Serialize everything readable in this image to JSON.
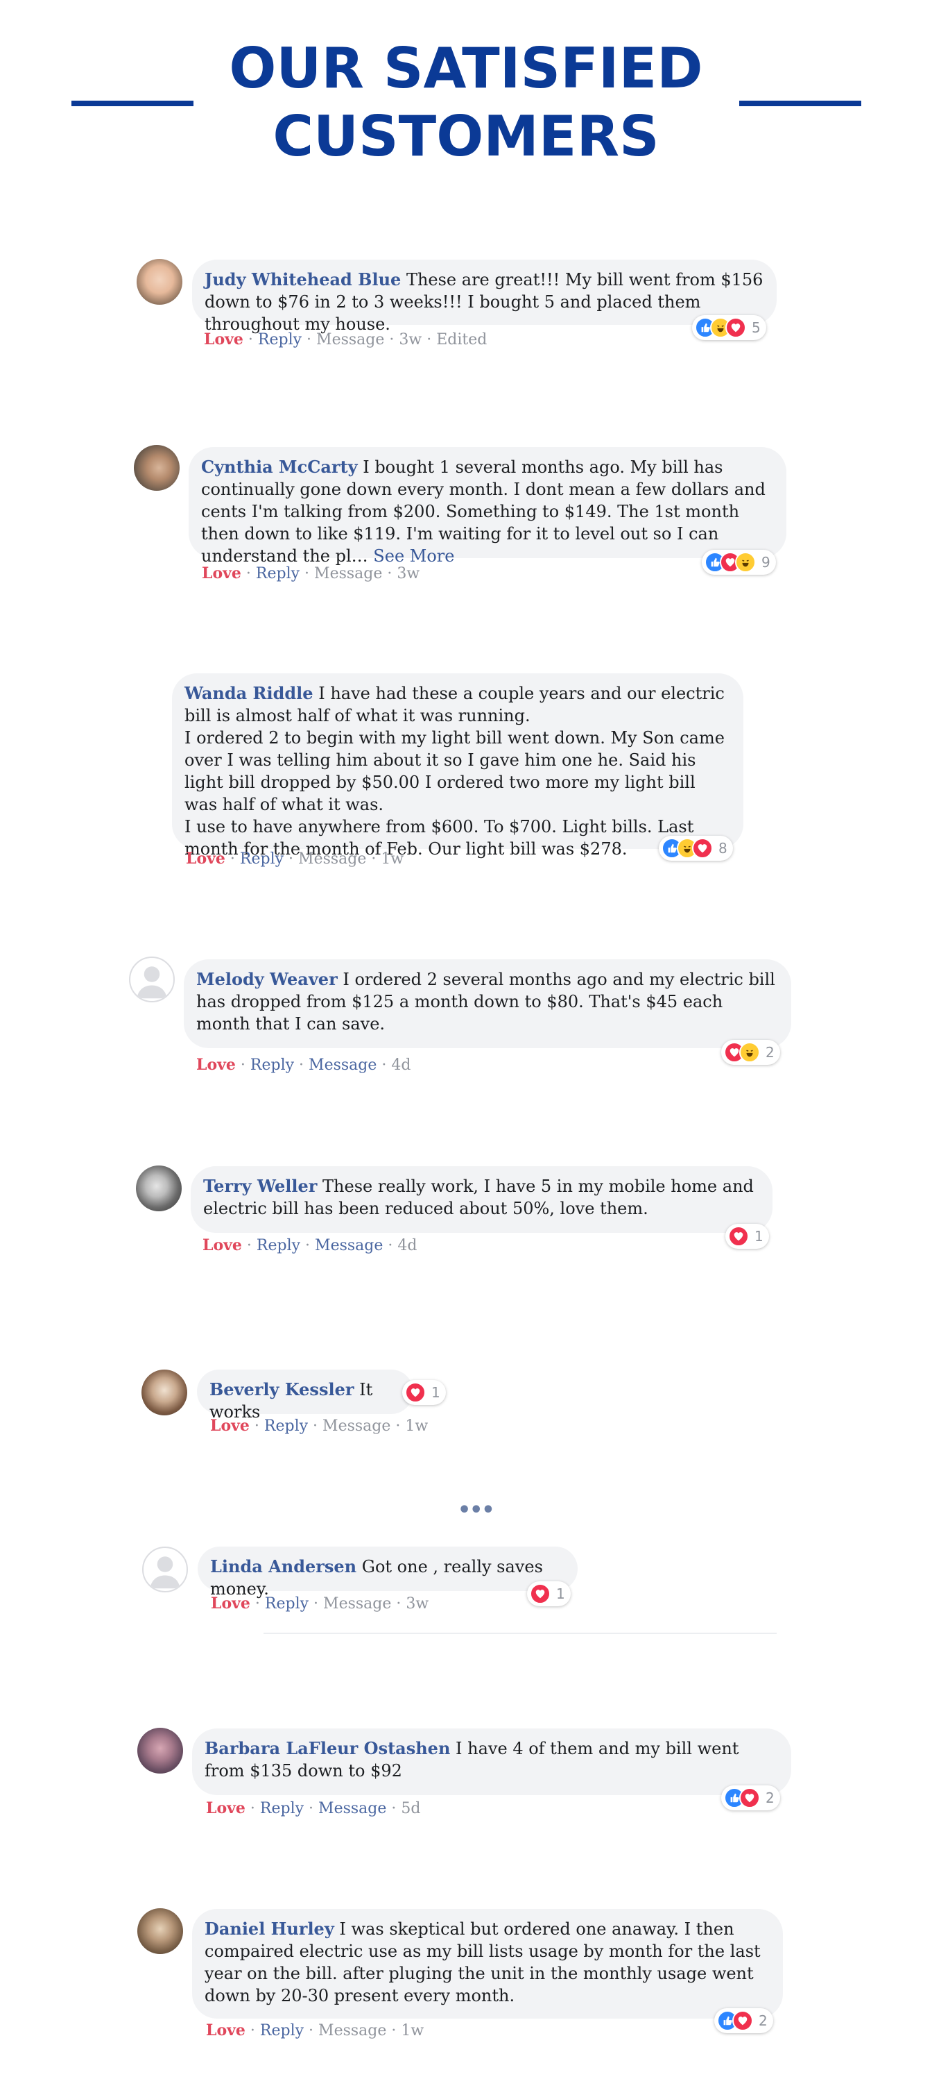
{
  "page": {
    "title_line1": "OUR SATISFIED",
    "title_line2": "CUSTOMERS",
    "accent_color": "#0b3a96"
  },
  "labels": {
    "love": "Love",
    "reply": "Reply",
    "message": "Message",
    "sep": " · "
  },
  "comments": [
    {
      "author": "Judy Whitehead Blue",
      "text": "These are great!!! My bill went from $156 down to $76 in 2 to 3 weeks!!! I bought 5 and placed them throughout my house.",
      "time": "3w",
      "edited": "Edited",
      "reactions": [
        "like",
        "haha",
        "love"
      ],
      "count": "5"
    },
    {
      "author": "Cynthia McCarty",
      "text": "I bought 1 several months ago. My bill has continually gone down every month. I dont mean a few dollars and cents I'm talking from $200. Something to $149. The 1st month then down to like $119. I'm waiting for it to level out so I can understand the pl…",
      "see_more": "See More",
      "time": "3w",
      "reactions": [
        "like",
        "love",
        "haha"
      ],
      "count": "9"
    },
    {
      "author": "Wanda Riddle",
      "text": "I have had these a couple years and our electric bill is almost half of what it was running.",
      "text2": "I ordered 2 to begin with my light bill went down. My Son came over I was telling him about it so I gave him one he. Said his light bill dropped by $50.00 I ordered two more my light bill was half of what it was.",
      "text3": "I use to have anywhere from $600. To $700. Light bills. Last month for the month of Feb. Our light bill was $278.",
      "time": "1w",
      "reactions": [
        "like",
        "haha",
        "love"
      ],
      "count": "8"
    },
    {
      "author": "Melody Weaver",
      "text": "I ordered 2 several months ago and my electric bill has dropped from $125 a month down to $80. That's $45 each month that I can save.",
      "time": "4d",
      "reactions": [
        "love",
        "haha"
      ],
      "count": "2"
    },
    {
      "author": "Terry Weller",
      "text": "These really work, I have 5 in my mobile home and electric bill has been reduced about 50%, love them.",
      "time": "4d",
      "reactions": [
        "love"
      ],
      "count": "1"
    },
    {
      "author": "Beverly Kessler",
      "text": "It works",
      "time": "1w",
      "reactions": [
        "love"
      ],
      "count": "1"
    },
    {
      "author": "Linda Andersen",
      "text": "Got one , really saves money.",
      "time": "3w",
      "reactions": [
        "love"
      ],
      "count": "1"
    },
    {
      "author": "Barbara LaFleur Ostashen",
      "text": "I have 4 of them and my bill went from $135 down to $92",
      "time": "5d",
      "reactions": [
        "like",
        "love"
      ],
      "count": "2"
    },
    {
      "author": "Daniel Hurley",
      "text": "I was skeptical but ordered one anaway. I then compaired electric use as my bill lists usage by month for the last year on the bill. after pluging the unit in the monthly usage went down by 20-30 present every month.",
      "time": "1w",
      "reactions": [
        "like",
        "love"
      ],
      "count": "2"
    }
  ],
  "more_dots": "•••"
}
